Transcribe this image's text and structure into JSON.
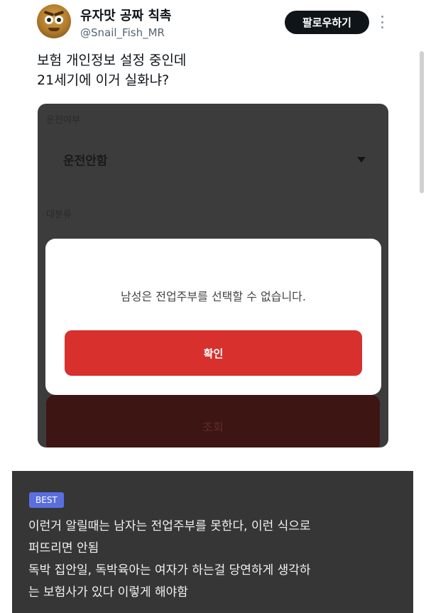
{
  "tweet": {
    "display_name": "유자맛 공짜 칙촉",
    "handle": "@Snail_Fish_MR",
    "follow_label": "팔로우하기",
    "text": "보험 개인정보 설정 중인데\n21세기에 이거 실화냐?"
  },
  "app_screenshot": {
    "drive_label": "운전여부",
    "drive_value": "운전안함",
    "category_label": "대분류",
    "lookup_button": "조회",
    "dialog": {
      "message": "남성은 전업주부를 선택할 수 없습니다.",
      "confirm_label": "확인"
    }
  },
  "comment": {
    "badge": "BEST",
    "lines": [
      "이런거 알릴때는 남자는 전업주부를 못한다, 이런 식으로",
      "퍼뜨리면 안됨",
      "독박 집안일, 독박육아는 여자가 하는걸 당연하게 생각하",
      "는 보험사가 있다 이렇게 해야함"
    ]
  },
  "colors": {
    "follow_button": "#0f1419",
    "confirm_button": "#d7302d",
    "best_badge": "#5b6ee0",
    "comment_panel": "#363636"
  },
  "icons": {
    "more": "more-vertical-icon",
    "dropdown": "caret-down-icon"
  }
}
